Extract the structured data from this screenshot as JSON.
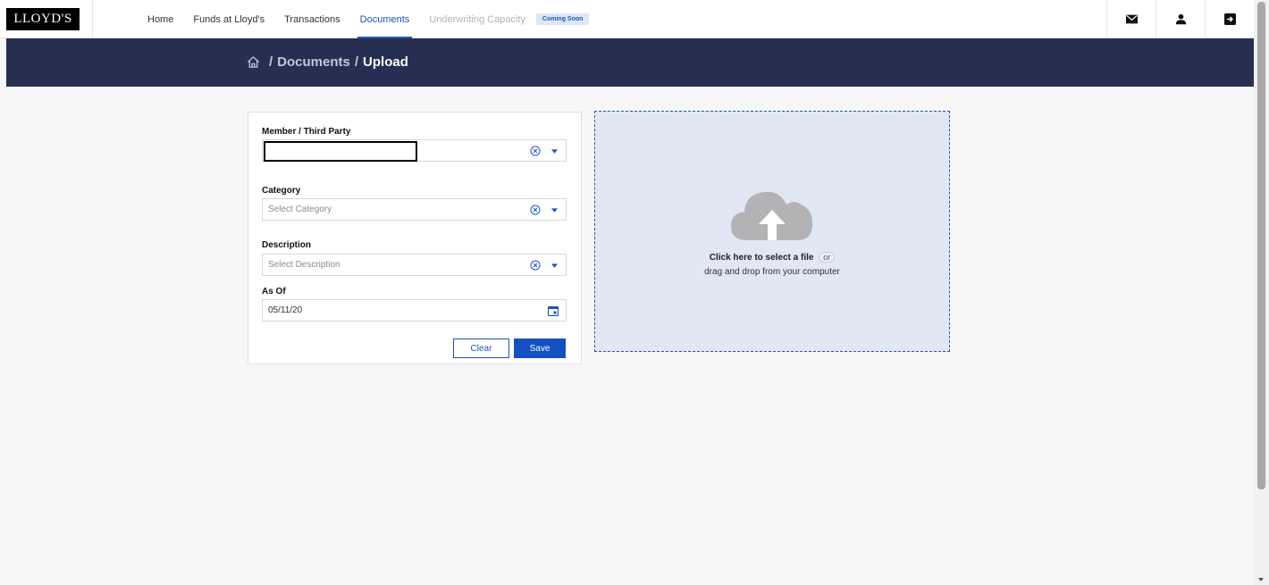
{
  "header": {
    "logo_text": "LLOYD'S",
    "nav": [
      {
        "label": "Home",
        "state": "normal"
      },
      {
        "label": "Funds at Lloyd's",
        "state": "normal"
      },
      {
        "label": "Transactions",
        "state": "normal"
      },
      {
        "label": "Documents",
        "state": "active"
      },
      {
        "label": "Underwriting Capacity",
        "state": "disabled"
      }
    ],
    "badge": "Coming Soon",
    "icons": [
      "mail-icon",
      "user-icon",
      "logout-icon"
    ]
  },
  "breadcrumb": {
    "home_icon": "home-icon",
    "items": [
      "Documents"
    ],
    "current": "Upload"
  },
  "form": {
    "member": {
      "label": "Member / Third Party",
      "value": ""
    },
    "category": {
      "label": "Category",
      "placeholder": "Select Category"
    },
    "description": {
      "label": "Description",
      "placeholder": "Select Description"
    },
    "as_of": {
      "label": "As Of",
      "value": "05/11/20"
    },
    "clear_label": "Clear",
    "save_label": "Save"
  },
  "dropzone": {
    "icon": "cloud-upload-icon",
    "primary": "Click here to select a file",
    "or": "or",
    "secondary": "drag and drop from your computer"
  },
  "colors": {
    "accent": "#1f55b8",
    "band": "#262f51",
    "dropzone_bg": "#e2e7f4"
  }
}
